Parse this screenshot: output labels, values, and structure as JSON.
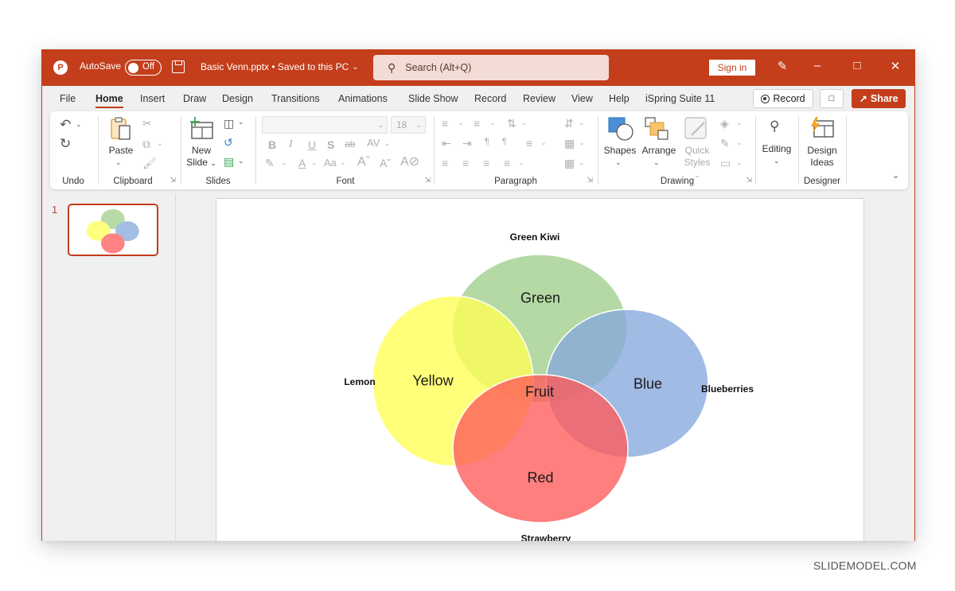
{
  "titlebar": {
    "autosave_label": "AutoSave",
    "autosave_state": "Off",
    "document_title": "Basic Venn.pptx • Saved to this PC",
    "search_placeholder": "Search (Alt+Q)",
    "sign_in": "Sign in",
    "icons": [
      "powerpoint-logo-icon",
      "save-icon",
      "chevron-down-icon",
      "search-icon",
      "pen-sparkle-icon",
      "minimize-icon",
      "maximize-icon",
      "close-icon"
    ]
  },
  "ribbon_tabs": [
    {
      "label": "File",
      "active": false
    },
    {
      "label": "Home",
      "active": true
    },
    {
      "label": "Insert",
      "active": false
    },
    {
      "label": "Draw",
      "active": false
    },
    {
      "label": "Design",
      "active": false
    },
    {
      "label": "Transitions",
      "active": false
    },
    {
      "label": "Animations",
      "active": false
    },
    {
      "label": "Slide Show",
      "active": false
    },
    {
      "label": "Record",
      "active": false
    },
    {
      "label": "Review",
      "active": false
    },
    {
      "label": "View",
      "active": false
    },
    {
      "label": "Help",
      "active": false
    },
    {
      "label": "iSpring Suite 11",
      "active": false
    }
  ],
  "ribbon_actions": {
    "record": "Record",
    "share": "Share"
  },
  "ribbon": {
    "groups": {
      "undo": "Undo",
      "clipboard": "Clipboard",
      "slides": "Slides",
      "font": "Font",
      "paragraph": "Paragraph",
      "drawing": "Drawing",
      "designer": "Designer"
    },
    "buttons": {
      "paste": "Paste",
      "new_slide_1": "New",
      "new_slide_2": "Slide",
      "shapes": "Shapes",
      "arrange": "Arrange",
      "quick_styles_1": "Quick",
      "quick_styles_2": "Styles",
      "editing": "Editing",
      "design_ideas_1": "Design",
      "design_ideas_2": "Ideas"
    },
    "font": {
      "family_value": "",
      "size_value": "18"
    }
  },
  "slides_pane": {
    "slide_number": "1"
  },
  "slide": {
    "venn": {
      "circles": [
        {
          "name": "green",
          "label": "Green",
          "outer_label": "Green Kiwi",
          "color": "#9fce8a"
        },
        {
          "name": "yellow",
          "label": "Yellow",
          "outer_label": "Lemon",
          "color": "#ffff55"
        },
        {
          "name": "blue",
          "label": "Blue",
          "outer_label": "Blueberries",
          "color": "#85a8dd"
        },
        {
          "name": "red",
          "label": "Red",
          "outer_label": "Strawberry",
          "color": "#ff5a5a"
        }
      ],
      "center_label": "Fruit"
    }
  },
  "watermark": "SLIDEMODEL.COM",
  "colors": {
    "accent": "#c43e1c",
    "search_bg": "#f3dcd6"
  }
}
